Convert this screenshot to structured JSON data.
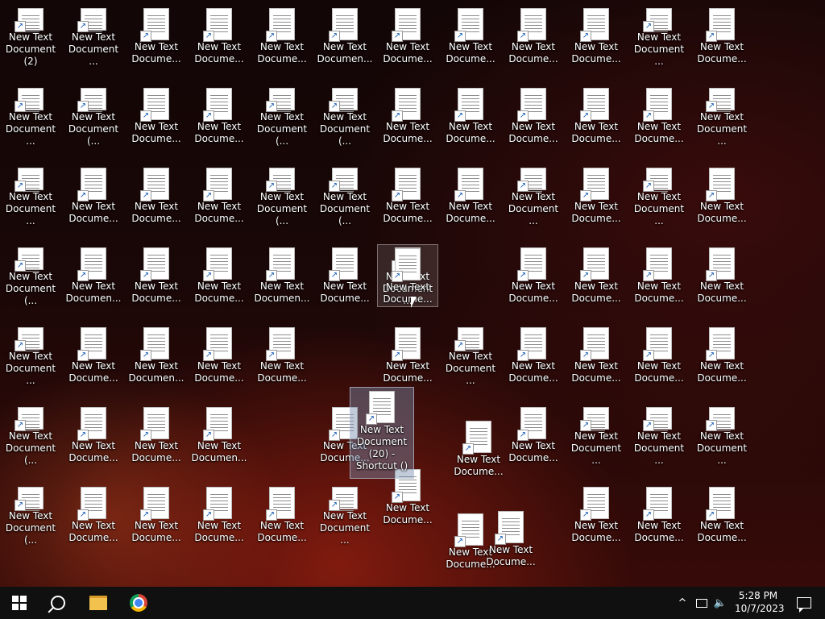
{
  "desktop": {
    "items": [
      {
        "label": "New Text Document (2)"
      },
      {
        "label": "New Text Document ..."
      },
      {
        "label": "New Text Docume..."
      },
      {
        "label": "New Text Docume..."
      },
      {
        "label": "New Text Docume..."
      },
      {
        "label": "New Text Documen..."
      },
      {
        "label": "New Text Docume..."
      },
      {
        "label": "New Text Docume..."
      },
      {
        "label": "New Text Docume..."
      },
      {
        "label": "New Text Docume..."
      },
      {
        "label": "New Text Document ..."
      },
      {
        "label": "New Text Docume..."
      },
      {
        "label": "New Text Document ..."
      },
      {
        "label": "New Text Document (..."
      },
      {
        "label": "New Text Docume..."
      },
      {
        "label": "New Text Docume..."
      },
      {
        "label": "New Text Document (..."
      },
      {
        "label": "New Text Document (..."
      },
      {
        "label": "New Text Docume..."
      },
      {
        "label": "New Text Docume..."
      },
      {
        "label": "New Text Docume..."
      },
      {
        "label": "New Text Docume..."
      },
      {
        "label": "New Text Docume..."
      },
      {
        "label": "New Text Document ..."
      },
      {
        "label": "New Text Document ..."
      },
      {
        "label": "New Text Docume..."
      },
      {
        "label": "New Text Docume..."
      },
      {
        "label": "New Text Docume..."
      },
      {
        "label": "New Text Document (..."
      },
      {
        "label": "New Text Document (..."
      },
      {
        "label": "New Text Docume..."
      },
      {
        "label": "New Text Docume..."
      },
      {
        "label": "New Text Document ..."
      },
      {
        "label": "New Text Docume..."
      },
      {
        "label": "New Text Document ..."
      },
      {
        "label": "New Text Docume..."
      },
      {
        "label": "New Text Docume..."
      },
      {
        "label": "New Text Document (..."
      },
      {
        "label": "New Text Documen..."
      },
      {
        "label": "New Text Docume..."
      },
      {
        "label": "New Text Docume..."
      },
      {
        "label": "New Text Documen..."
      },
      {
        "label": "New Text Docume..."
      },
      {
        "label": "New Text Document ..."
      },
      {
        "label": "New Text Docume..."
      },
      {
        "label": "New Text Docume..."
      },
      {
        "label": "New Text Docume..."
      },
      {
        "label": "New Text Docume..."
      },
      {
        "label": "New Text Docume..."
      },
      {
        "label": "New Text Docume..."
      },
      {
        "label": "New Text Document ..."
      },
      {
        "label": "New Text Docume..."
      },
      {
        "label": "New Text Documen..."
      },
      {
        "label": "New Text Docume..."
      },
      {
        "label": "New Text Docume..."
      },
      {
        "label": "New Text Docume..."
      },
      {
        "label": "New Text Document ..."
      },
      {
        "label": "New Text Docume..."
      },
      {
        "label": "New Text Docume..."
      },
      {
        "label": "New Text Docume..."
      },
      {
        "label": "New Text Docume..."
      },
      {
        "label": "New Text Docume..."
      },
      {
        "label": "New Text Document (..."
      },
      {
        "label": "New Text Docume..."
      },
      {
        "label": "New Text Docume..."
      },
      {
        "label": "New Text Documen..."
      },
      {
        "label": "New Text Docume..."
      },
      {
        "label": "New Text Docume..."
      },
      {
        "label": "New Text Docume..."
      },
      {
        "label": "New Text Docume..."
      },
      {
        "label": "New Text Document ..."
      },
      {
        "label": "New Text Document ..."
      },
      {
        "label": "New Text Document ..."
      },
      {
        "label": "New Text Document ..."
      },
      {
        "label": "New Text Document (..."
      },
      {
        "label": "New Text Docume..."
      },
      {
        "label": "New Text Docume..."
      },
      {
        "label": "New Text Docume..."
      },
      {
        "label": "New Text Docume..."
      },
      {
        "label": "New Text Document ..."
      },
      {
        "label": "New Text Docume..."
      },
      {
        "label": "New Text Docume..."
      },
      {
        "label": "New Text Docume..."
      },
      {
        "label": "New Text Docume..."
      },
      {
        "label": "New Text Docume..."
      },
      {
        "label": "New Text Docume..."
      }
    ],
    "drag_ghost_label": "New Text Document (20) - Shortcut ()",
    "arrow_glyph": "↗"
  },
  "taskbar": {
    "clock_time": "5:28 PM",
    "clock_date": "10/7/2023",
    "tray_chevron": "^",
    "volume_glyph": "🔈"
  }
}
